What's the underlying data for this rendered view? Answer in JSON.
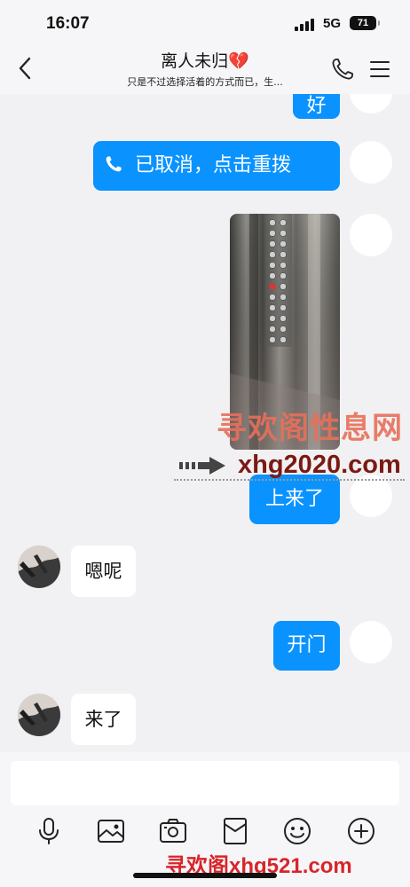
{
  "status_bar": {
    "time": "16:07",
    "network": "5G",
    "battery": "71"
  },
  "header": {
    "title": "离人未归💔",
    "subtitle": "只是不过选择活着的方式而已，生...",
    "back_icon": "chevron-left-icon",
    "call_icon": "phone-icon",
    "menu_icon": "hamburger-menu-icon"
  },
  "messages": [
    {
      "side": "right",
      "type": "text",
      "text": "好"
    },
    {
      "side": "right",
      "type": "call",
      "text": "已取消，点击重拨",
      "icon": "phone-icon"
    },
    {
      "side": "right",
      "type": "image",
      "description_icon": "photo"
    },
    {
      "side": "right",
      "type": "text",
      "text": "上来了"
    },
    {
      "side": "left",
      "type": "text",
      "text": "嗯呢"
    },
    {
      "side": "right",
      "type": "text",
      "text": "开门"
    },
    {
      "side": "left",
      "type": "text",
      "text": "来了"
    }
  ],
  "watermarks": {
    "top_line1": "寻欢阁性息网",
    "top_line2": "xhg2020.com",
    "bottom": "寻欢阁xhg521.com"
  },
  "input": {
    "placeholder": ""
  },
  "toolbar": [
    {
      "icon": "microphone-icon"
    },
    {
      "icon": "image-icon"
    },
    {
      "icon": "camera-icon"
    },
    {
      "icon": "red-packet-icon"
    },
    {
      "icon": "emoji-icon"
    },
    {
      "icon": "plus-icon"
    }
  ],
  "colors": {
    "accent_blue": "#0a93ff",
    "chat_background": "#f1f1f3"
  }
}
